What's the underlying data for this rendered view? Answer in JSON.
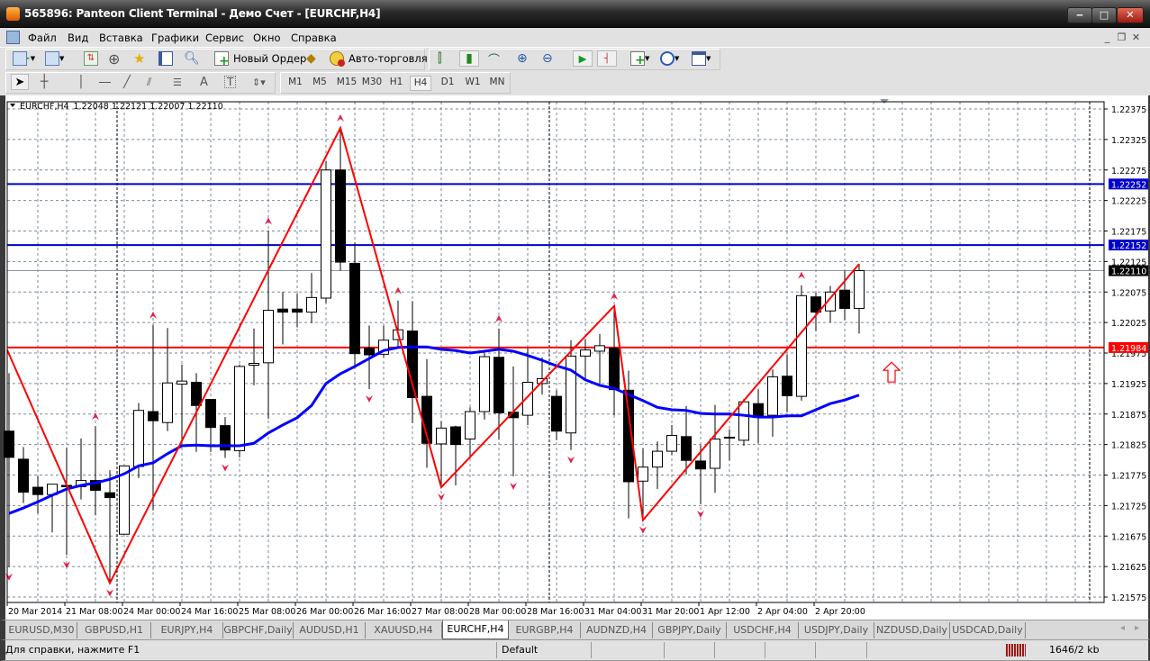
{
  "window": {
    "title": "565896: Panteon Client Terminal - Демо Счет - [EURCHF,H4]",
    "buttons": {
      "minimize": "‒",
      "maximize": "□",
      "close": "✕"
    }
  },
  "menu": {
    "items": [
      {
        "label": "Файл"
      },
      {
        "label": "Вид"
      },
      {
        "label": "Вставка"
      },
      {
        "label": "Графики"
      },
      {
        "label": "Сервис"
      },
      {
        "label": "Окно"
      },
      {
        "label": "Справка"
      }
    ],
    "mdi_buttons": {
      "minimize": "_",
      "restore": "❐",
      "close": "✕"
    }
  },
  "toolbar": {
    "new_order": "Новый Ордер",
    "auto_trading": "Авто-торговля",
    "icons": [
      "new-chart-icon",
      "profiles-icon",
      "market-watch-icon",
      "crosshair-navigator-icon",
      "favorites-icon",
      "terminal-icon",
      "strategy-tester-icon",
      "new-order-icon",
      "history-icon",
      "auto-trading-icon",
      "bar-chart-icon",
      "candlestick-icon",
      "line-chart-icon",
      "zoom-in-icon",
      "zoom-out-icon",
      "autoscroll-icon",
      "chart-shift-icon",
      "indicators-icon",
      "periods-icon",
      "templates-icon"
    ],
    "search": {
      "value": "",
      "placeholder": ""
    },
    "notification_count": "5"
  },
  "drawing_toolbar": {
    "tools": [
      "cursor-icon",
      "crosshair-icon",
      "vertical-line-icon",
      "horizontal-line-icon",
      "trendline-icon",
      "fibonacci-fan-icon",
      "fibonacci-retracement-icon",
      "text-icon",
      "text-label-icon",
      "arrows-icon"
    ],
    "text_tool_label": "A",
    "timeframes": [
      "M1",
      "M5",
      "M15",
      "M30",
      "H1",
      "H4",
      "D1",
      "W1",
      "MN"
    ],
    "active_timeframe": "H4"
  },
  "chart_data": {
    "type": "candlestick",
    "symbol_header": "EURCHF,H4",
    "ohlc_header": "1.22048 1.22121 1.22007 1.22110",
    "ylim": [
      1.21555,
      1.22395
    ],
    "y_ticks": [
      "1.22375",
      "1.22325",
      "1.22275",
      "1.22225",
      "1.22175",
      "1.22125",
      "1.22075",
      "1.22025",
      "1.21975",
      "1.21925",
      "1.21875",
      "1.21825",
      "1.21775",
      "1.21725",
      "1.21675",
      "1.21625",
      "1.21575"
    ],
    "time_labels": [
      {
        "bar": 0,
        "label": "20 Mar 2014"
      },
      {
        "bar": 4,
        "label": "21 Mar 08:00"
      },
      {
        "bar": 8,
        "label": "24 Mar 00:00"
      },
      {
        "bar": 12,
        "label": "24 Mar 16:00"
      },
      {
        "bar": 16,
        "label": "25 Mar 08:00"
      },
      {
        "bar": 20,
        "label": "26 Mar 00:00"
      },
      {
        "bar": 24,
        "label": "26 Mar 16:00"
      },
      {
        "bar": 28,
        "label": "27 Mar 08:00"
      },
      {
        "bar": 32,
        "label": "28 Mar 00:00"
      },
      {
        "bar": 36,
        "label": "28 Mar 16:00"
      },
      {
        "bar": 40,
        "label": "31 Mar 04:00"
      },
      {
        "bar": 44,
        "label": "31 Mar 20:00"
      },
      {
        "bar": 48,
        "label": "1 Apr 12:00"
      },
      {
        "bar": 52,
        "label": "2 Apr 04:00"
      },
      {
        "bar": 56,
        "label": "2 Apr 20:00"
      }
    ],
    "candles_ohlc": [
      [
        1.21847,
        1.21942,
        1.21624,
        1.21804
      ],
      [
        1.21801,
        1.21821,
        1.21729,
        1.21747
      ],
      [
        1.21755,
        1.21773,
        1.21712,
        1.21743
      ],
      [
        1.21743,
        1.2176,
        1.21681,
        1.2176
      ],
      [
        1.21758,
        1.2182,
        1.21644,
        1.21756
      ],
      [
        1.21756,
        1.21835,
        1.21735,
        1.21766
      ],
      [
        1.21766,
        1.21855,
        1.21709,
        1.2175
      ],
      [
        1.21746,
        1.21783,
        1.21598,
        1.21738
      ],
      [
        1.21678,
        1.2179,
        1.21678,
        1.2179
      ],
      [
        1.21789,
        1.21893,
        1.2177,
        1.21881
      ],
      [
        1.21879,
        1.22021,
        1.21717,
        1.21864
      ],
      [
        1.21861,
        1.22016,
        1.21847,
        1.21926
      ],
      [
        1.21924,
        1.21956,
        1.21827,
        1.21929
      ],
      [
        1.21927,
        1.21942,
        1.21813,
        1.21889
      ],
      [
        1.21899,
        1.21899,
        1.21813,
        1.21853
      ],
      [
        1.21856,
        1.2187,
        1.21803,
        1.21816
      ],
      [
        1.21815,
        1.21956,
        1.21804,
        1.21953
      ],
      [
        1.21955,
        1.22015,
        1.21922,
        1.21958
      ],
      [
        1.21959,
        1.22175,
        1.21867,
        1.22045
      ],
      [
        1.22047,
        1.22075,
        1.21989,
        1.22042
      ],
      [
        1.22047,
        1.22072,
        1.22017,
        1.22042
      ],
      [
        1.22042,
        1.22106,
        1.22024,
        1.22066
      ],
      [
        1.22065,
        1.2229,
        1.22057,
        1.22275
      ],
      [
        1.22275,
        1.22344,
        1.2211,
        1.22124
      ],
      [
        1.22122,
        1.22156,
        1.2195,
        1.21974
      ],
      [
        1.21983,
        1.2202,
        1.21916,
        1.21972
      ],
      [
        1.21973,
        1.2202,
        1.21968,
        1.21996
      ],
      [
        1.21997,
        1.22061,
        1.21983,
        1.22013
      ],
      [
        1.22011,
        1.2206,
        1.2186,
        1.21902
      ],
      [
        1.21904,
        1.21965,
        1.21787,
        1.21827
      ],
      [
        1.21826,
        1.21863,
        1.21755,
        1.21852
      ],
      [
        1.21854,
        1.21856,
        1.21758,
        1.21825
      ],
      [
        1.21834,
        1.21886,
        1.21804,
        1.21879
      ],
      [
        1.21879,
        1.21974,
        1.21866,
        1.21969
      ],
      [
        1.21968,
        1.22015,
        1.21833,
        1.21877
      ],
      [
        1.21878,
        1.21953,
        1.21773,
        1.21869
      ],
      [
        1.21873,
        1.21983,
        1.21857,
        1.21927
      ],
      [
        1.21925,
        1.21968,
        1.21907,
        1.21933
      ],
      [
        1.21904,
        1.21914,
        1.21832,
        1.21847
      ],
      [
        1.21844,
        1.21996,
        1.21816,
        1.2197
      ],
      [
        1.2197,
        1.21998,
        1.21932,
        1.2198
      ],
      [
        1.21978,
        1.22006,
        1.21921,
        1.21987
      ],
      [
        1.21983,
        1.22052,
        1.21873,
        1.21915
      ],
      [
        1.21914,
        1.21946,
        1.21704,
        1.21764
      ],
      [
        1.21765,
        1.21819,
        1.21701,
        1.21788
      ],
      [
        1.21788,
        1.2183,
        1.21752,
        1.21814
      ],
      [
        1.21814,
        1.21857,
        1.21808,
        1.2184
      ],
      [
        1.21838,
        1.21888,
        1.21776,
        1.21799
      ],
      [
        1.21798,
        1.21824,
        1.21727,
        1.21785
      ],
      [
        1.21786,
        1.2189,
        1.21746,
        1.21834
      ],
      [
        1.21837,
        1.2185,
        1.21799,
        1.21837
      ],
      [
        1.21832,
        1.219,
        1.21823,
        1.21895
      ],
      [
        1.21892,
        1.21915,
        1.21827,
        1.2187
      ],
      [
        1.21873,
        1.21948,
        1.21838,
        1.21936
      ],
      [
        1.21937,
        1.21973,
        1.21878,
        1.21905
      ],
      [
        1.21904,
        1.22086,
        1.21897,
        1.22069
      ],
      [
        1.22067,
        1.22074,
        1.22011,
        1.22042
      ],
      [
        1.22044,
        1.22085,
        1.22025,
        1.22075
      ],
      [
        1.22078,
        1.2211,
        1.22029,
        1.22048
      ],
      [
        1.22048,
        1.22121,
        1.22007,
        1.2211
      ]
    ],
    "moving_average": [
      1.21712,
      1.21721,
      1.21731,
      1.21742,
      1.21752,
      1.21758,
      1.21762,
      1.21768,
      1.21777,
      1.2179,
      1.21795,
      1.2181,
      1.21823,
      1.21824,
      1.21823,
      1.21823,
      1.21823,
      1.21827,
      1.21844,
      1.21857,
      1.21869,
      1.21889,
      1.21925,
      1.21941,
      1.21953,
      1.21966,
      1.21979,
      1.21984,
      1.21985,
      1.21985,
      1.21981,
      1.21979,
      1.21975,
      1.21978,
      1.21981,
      1.21978,
      1.21971,
      1.21963,
      1.21954,
      1.21947,
      1.21931,
      1.21922,
      1.21917,
      1.21907,
      1.21897,
      1.21886,
      1.21882,
      1.21881,
      1.21876,
      1.21875,
      1.21875,
      1.21873,
      1.2187,
      1.2187,
      1.21872,
      1.21872,
      1.21882,
      1.21892,
      1.21898,
      1.21906
    ],
    "zigzag": [
      {
        "bar": 0,
        "price": 1.2198
      },
      {
        "bar": 7,
        "price": 1.21598
      },
      {
        "bar": 23,
        "price": 1.22344
      },
      {
        "bar": 30,
        "price": 1.21755
      },
      {
        "bar": 42,
        "price": 1.22052
      },
      {
        "bar": 44,
        "price": 1.21701
      },
      {
        "bar": 59,
        "price": 1.22121
      }
    ],
    "fractals_up": [
      6,
      10,
      18,
      23,
      27,
      34,
      42,
      55
    ],
    "fractals_down": [
      0,
      4,
      7,
      15,
      25,
      30,
      35,
      39,
      44,
      48
    ],
    "period_separators": [
      7.5,
      37.5
    ],
    "horizontal_lines": [
      {
        "price": 1.22252,
        "label": "1.22252",
        "color": "#0000cc"
      },
      {
        "price": 1.22152,
        "label": "1.22152",
        "color": "#0000cc"
      },
      {
        "price": 1.21984,
        "label": "1.21984",
        "color": "#ff0000"
      }
    ],
    "current_price": {
      "price": 1.2211,
      "label": "1.22110"
    },
    "arrow_object": {
      "bar": 62,
      "price": 1.2196,
      "direction": "up",
      "color": "#ff0000"
    },
    "colors": {
      "bull": "#ffffff",
      "bear": "#000000",
      "ma": "#0000ff",
      "zigzag": "#ff0000",
      "fractal": "#e0204a",
      "grid": "#7a8a9a"
    },
    "grid": true
  },
  "tabs": [
    {
      "label": "EURUSD,M30"
    },
    {
      "label": "GBPUSD,H1"
    },
    {
      "label": "EURJPY,H4"
    },
    {
      "label": "GBPCHF,Daily"
    },
    {
      "label": "AUDUSD,H1"
    },
    {
      "label": "XAUUSD,H4"
    },
    {
      "label": "EURCHF,H4",
      "active": true
    },
    {
      "label": "EURGBP,H4"
    },
    {
      "label": "AUDNZD,H4"
    },
    {
      "label": "GBPJPY,Daily"
    },
    {
      "label": "USDCHF,H4"
    },
    {
      "label": "USDJPY,Daily"
    },
    {
      "label": "NZDUSD,Daily"
    },
    {
      "label": "USDCAD,Daily"
    }
  ],
  "tab_scroll": {
    "left": "◂",
    "right": "▸"
  },
  "status": {
    "help": "Для справки, нажмите F1",
    "profile": "Default",
    "traffic": "1646/2 kb"
  }
}
